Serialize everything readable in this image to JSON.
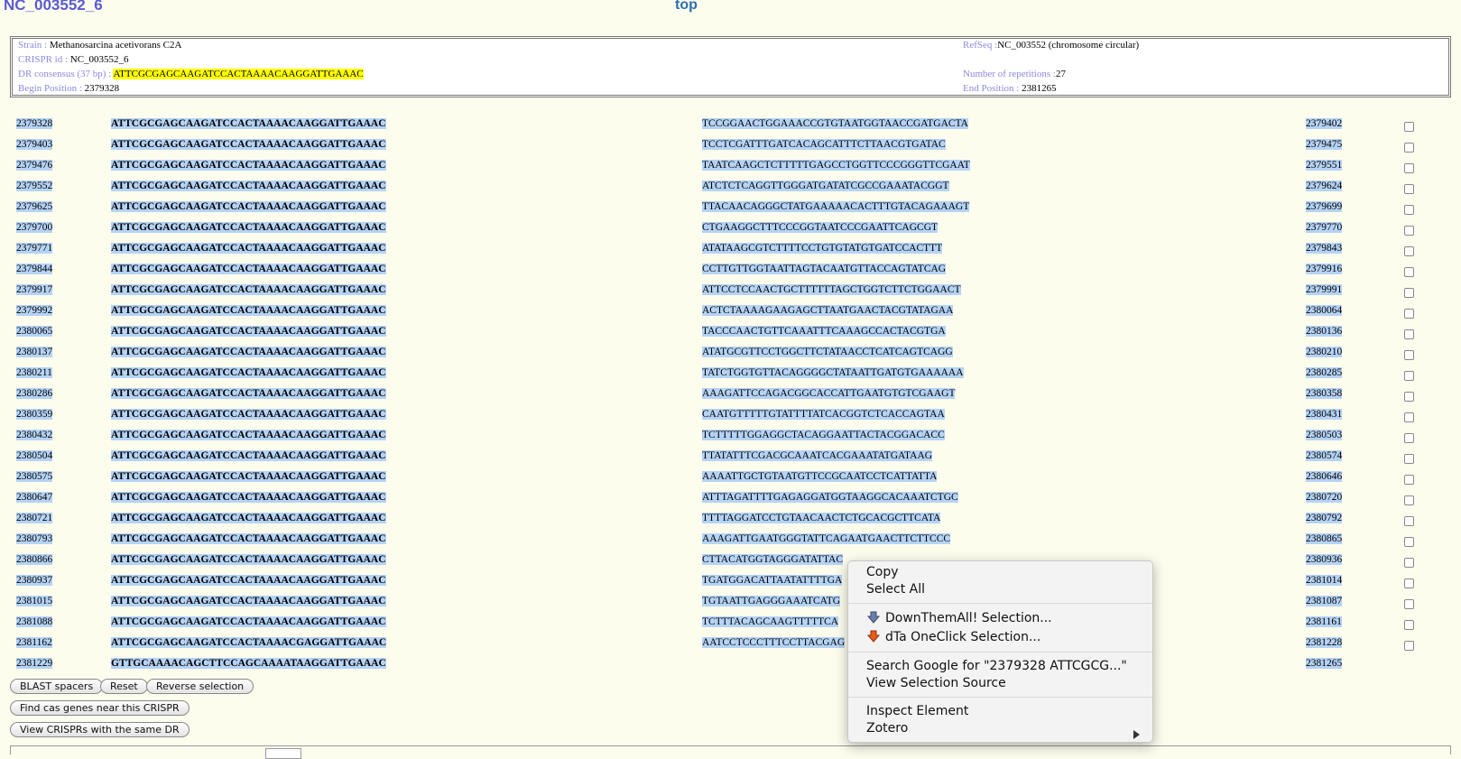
{
  "header": {
    "crispr_id": "NC_003552_6",
    "top_link": "top"
  },
  "info": {
    "strain_label": "Strain :",
    "strain_value": "Methanosarcina acetivorans C2A",
    "refseq_label": "RefSeq :",
    "refseq_value": "NC_003552 (chromosome circular)",
    "crispr_id_label": "CRISPR id :",
    "crispr_id_value": "NC_003552_6",
    "dr_label": "DR consensus (37 bp) :",
    "dr_value": "ATTCGCGAGCAAGATCCACTAAAACAAGGATTGAAAC",
    "reps_label": "Number of repetitions :",
    "reps_value": "27",
    "begin_label": "Begin Position :",
    "begin_value": "2379328",
    "end_label": "End Position :",
    "end_value": "2381265"
  },
  "rows": [
    {
      "begin": "2379328",
      "dr": "ATTCGCGAGCAAGATCCACTAAAACAAGGATTGAAAC",
      "spacer": "TCCGGAACTGGAAACCGTGTAATGGTAACCGATGACTA",
      "end": "2379402"
    },
    {
      "begin": "2379403",
      "dr": "ATTCGCGAGCAAGATCCACTAAAACAAGGATTGAAAC",
      "spacer": "TCCTCGATTTGATCACAGCATTTCTTAACGTGATAC",
      "end": "2379475"
    },
    {
      "begin": "2379476",
      "dr": "ATTCGCGAGCAAGATCCACTAAAACAAGGATTGAAAC",
      "spacer": "TAATCAAGCTCTTTTTGAGCCTGGTTCCCGGGTTCGAAT",
      "end": "2379551"
    },
    {
      "begin": "2379552",
      "dr": "ATTCGCGAGCAAGATCCACTAAAACAAGGATTGAAAC",
      "spacer": "ATCTCTCAGGTTGGGATGATATCGCCGAAATACGGT",
      "end": "2379624"
    },
    {
      "begin": "2379625",
      "dr": "ATTCGCGAGCAAGATCCACTAAAACAAGGATTGAAAC",
      "spacer": "TTACAACAGGGCTATGAAAAACACTTTGTACAGAAAGT",
      "end": "2379699"
    },
    {
      "begin": "2379700",
      "dr": "ATTCGCGAGCAAGATCCACTAAAACAAGGATTGAAAC",
      "spacer": "CTGAAGGCTTTCCCGGTAATCCCGAATTCAGCGT",
      "end": "2379770"
    },
    {
      "begin": "2379771",
      "dr": "ATTCGCGAGCAAGATCCACTAAAACAAGGATTGAAAC",
      "spacer": "ATATAAGCGTCTTTTCCTGTGTATGTGATCCACTTT",
      "end": "2379843"
    },
    {
      "begin": "2379844",
      "dr": "ATTCGCGAGCAAGATCCACTAAAACAAGGATTGAAAC",
      "spacer": "CCTTGTTGGTAATTAGTACAATGTTACCAGTATCAG",
      "end": "2379916"
    },
    {
      "begin": "2379917",
      "dr": "ATTCGCGAGCAAGATCCACTAAAACAAGGATTGAAAC",
      "spacer": "ATTCCTCCAACTGCTTTTTTAGCTGGTCTTCTGGAACT",
      "end": "2379991"
    },
    {
      "begin": "2379992",
      "dr": "ATTCGCGAGCAAGATCCACTAAAACAAGGATTGAAAC",
      "spacer": "ACTCTAAAAGAAGAGCTTAATGAACTACGTATAGAA",
      "end": "2380064"
    },
    {
      "begin": "2380065",
      "dr": "ATTCGCGAGCAAGATCCACTAAAACAAGGATTGAAAC",
      "spacer": "TACCCAACTGTTCAAATTTCAAAGCCACTACGTGA",
      "end": "2380136"
    },
    {
      "begin": "2380137",
      "dr": "ATTCGCGAGCAAGATCCACTAAAACAAGGATTGAAAC",
      "spacer": "ATATGCGTTCCTGGCTTCTATAACCTCATCAGTCAGG",
      "end": "2380210"
    },
    {
      "begin": "2380211",
      "dr": "ATTCGCGAGCAAGATCCACTAAAACAAGGATTGAAAC",
      "spacer": "TATCTGGTGTTACAGGGGCTATAATTGATGTGAAAAAA",
      "end": "2380285"
    },
    {
      "begin": "2380286",
      "dr": "ATTCGCGAGCAAGATCCACTAAAACAAGGATTGAAAC",
      "spacer": "AAAGATTCCAGACGGCACCATTGAATGTGTCGAAGT",
      "end": "2380358"
    },
    {
      "begin": "2380359",
      "dr": "ATTCGCGAGCAAGATCCACTAAAACAAGGATTGAAAC",
      "spacer": "CAATGTTTTTGTATTTTATCACGGTCTCACCAGTAA",
      "end": "2380431"
    },
    {
      "begin": "2380432",
      "dr": "ATTCGCGAGCAAGATCCACTAAAACAAGGATTGAAAC",
      "spacer": "TCTTTTTGGAGGCTACAGGAATTACTACGGACACC",
      "end": "2380503"
    },
    {
      "begin": "2380504",
      "dr": "ATTCGCGAGCAAGATCCACTAAAACAAGGATTGAAAC",
      "spacer": "TTATATTTCGACGCAAATCACGAAATATGATAAG",
      "end": "2380574"
    },
    {
      "begin": "2380575",
      "dr": "ATTCGCGAGCAAGATCCACTAAAACAAGGATTGAAAC",
      "spacer": "AAAATTGCTGTAATGTTCCGCAATCCTCATTATTA",
      "end": "2380646"
    },
    {
      "begin": "2380647",
      "dr": "ATTCGCGAGCAAGATCCACTAAAACAAGGATTGAAAC",
      "spacer": "ATTTAGATTTTGAGAGGATGGTAAGGCACAAATCTGC",
      "end": "2380720"
    },
    {
      "begin": "2380721",
      "dr": "ATTCGCGAGCAAGATCCACTAAAACAAGGATTGAAAC",
      "spacer": "TTTTAGGATCCTGTAACAACTCTGCACGCTTCATA",
      "end": "2380792"
    },
    {
      "begin": "2380793",
      "dr": "ATTCGCGAGCAAGATCCACTAAAACAAGGATTGAAAC",
      "spacer": "AAAGATTGAATGGGTATTCAGAATGAACTTCTTCCC",
      "end": "2380865"
    },
    {
      "begin": "2380866",
      "dr": "ATTCGCGAGCAAGATCCACTAAAACAAGGATTGAAAC",
      "spacer": "CTTACATGGTAGGGATATTAC",
      "end": "2380936"
    },
    {
      "begin": "2380937",
      "dr": "ATTCGCGAGCAAGATCCACTAAAACAAGGATTGAAAC",
      "spacer": "TGATGGACATTAATATTTTGA",
      "end": "2381014"
    },
    {
      "begin": "2381015",
      "dr": "ATTCGCGAGCAAGATCCACTAAAACAAGGATTGAAAC",
      "spacer": "TGTAATTGAGGGAAATCATG",
      "end": "2381087"
    },
    {
      "begin": "2381088",
      "dr": "ATTCGCGAGCAAGATCCACTAAAACAAGGATTGAAAC",
      "spacer": "TCTTTACAGCAAGTTTTTCA",
      "end": "2381161"
    },
    {
      "begin": "2381162",
      "dr": "ATTCGCGAGCAAGATCCACTAAAACGAGGATTGAAAC",
      "spacer": "AATCCTCCCTTTCCTTACGAG",
      "end": "2381228"
    },
    {
      "begin": "2381229",
      "dr": "GTTGCAAAACAGCTTCCAGCAAAATAAGGATTGAAAC",
      "spacer": "",
      "end": "2381265"
    }
  ],
  "buttons": {
    "blast": "BLAST spacers",
    "reset": "Reset",
    "reverse": "Reverse selection",
    "find_cas": "Find cas genes near this CRISPR",
    "view_same_dr": "View CRISPRs with the same DR"
  },
  "context_menu": {
    "copy": "Copy",
    "select_all": "Select All",
    "downthemall": "DownThemAll! Selection...",
    "dta_oneclick": "dTa OneClick Selection...",
    "search_google": "Search Google for \"2379328 ATTCGCG...\"",
    "view_source": "View Selection Source",
    "inspect": "Inspect Element",
    "zotero": "Zotero"
  },
  "colors": {
    "selection": "#b5d3f5",
    "highlight": "#ffff00",
    "label": "#8a8ae0",
    "title": "#5a5ad2",
    "background": "#fdfdee"
  }
}
